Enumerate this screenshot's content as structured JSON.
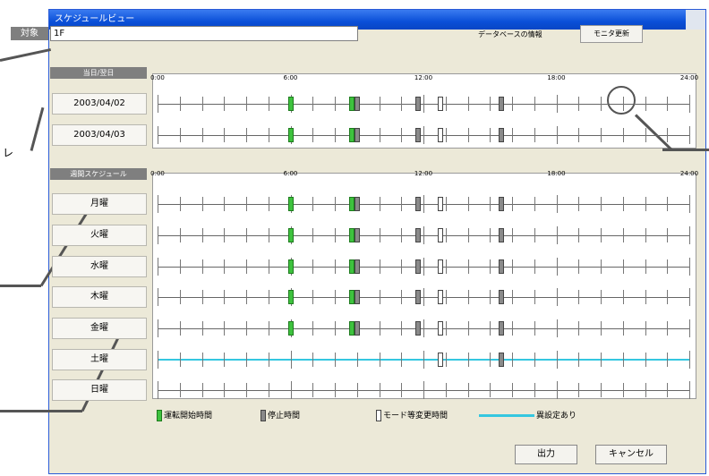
{
  "window": {
    "title": "スケジュールビュー"
  },
  "header": {
    "target_label": "対象",
    "target_value": "1F",
    "db_info": "データベースの情報",
    "monitor_button": "モニタ更新"
  },
  "sections": {
    "specific": "当日/翌日",
    "weekly": "週間スケジュール"
  },
  "time_ticks": [
    "0:00",
    "6:00",
    "12:00",
    "18:00",
    "24:00"
  ],
  "date_rows": [
    {
      "label": "2003/04/02",
      "start": [
        12.0,
        17.5
      ],
      "stop": [
        18.0,
        23.5
      ],
      "mode": [
        25.5
      ],
      "stop2": [
        31.0
      ]
    },
    {
      "label": "2003/04/03",
      "start": [
        12.0,
        17.5
      ],
      "stop": [
        18.0,
        23.5
      ],
      "mode": [
        25.5
      ],
      "stop2": [
        31.0
      ]
    }
  ],
  "weekly_rows": [
    {
      "label": "月曜",
      "start": [
        12.0,
        17.5
      ],
      "stop": [
        18.0,
        23.5
      ],
      "mode": [
        25.5
      ],
      "stop2": [
        31.0
      ],
      "diff": false
    },
    {
      "label": "火曜",
      "start": [
        12.0,
        17.5
      ],
      "stop": [
        18.0,
        23.5
      ],
      "mode": [
        25.5
      ],
      "stop2": [
        31.0
      ],
      "diff": false
    },
    {
      "label": "水曜",
      "start": [
        12.0,
        17.5
      ],
      "stop": [
        18.0,
        23.5
      ],
      "mode": [
        25.5
      ],
      "stop2": [
        31.0
      ],
      "diff": false
    },
    {
      "label": "木曜",
      "start": [
        12.0,
        17.5
      ],
      "stop": [
        18.0,
        23.5
      ],
      "mode": [
        25.5
      ],
      "stop2": [
        31.0
      ],
      "diff": false
    },
    {
      "label": "金曜",
      "start": [
        12.0,
        17.5
      ],
      "stop": [
        18.0,
        23.5
      ],
      "mode": [
        25.5
      ],
      "stop2": [
        31.0
      ],
      "diff": false
    },
    {
      "label": "土曜",
      "start": [],
      "stop": [],
      "mode": [
        25.5
      ],
      "stop2": [
        31.0
      ],
      "diff": true
    },
    {
      "label": "日曜",
      "start": [],
      "stop": [],
      "mode": [],
      "stop2": [],
      "diff": false
    }
  ],
  "legend": {
    "start": "運転開始時間",
    "stop": "停止時間",
    "mode": "モード等変更時間",
    "diff": "異設定あり"
  },
  "buttons": {
    "output": "出力",
    "cancel": "キャンセル"
  },
  "side_text": "レ",
  "colors": {
    "start": "#3ec23e",
    "stop": "#8a8a8a",
    "diff": "#35c7e0",
    "title": "#0a4fd8"
  }
}
